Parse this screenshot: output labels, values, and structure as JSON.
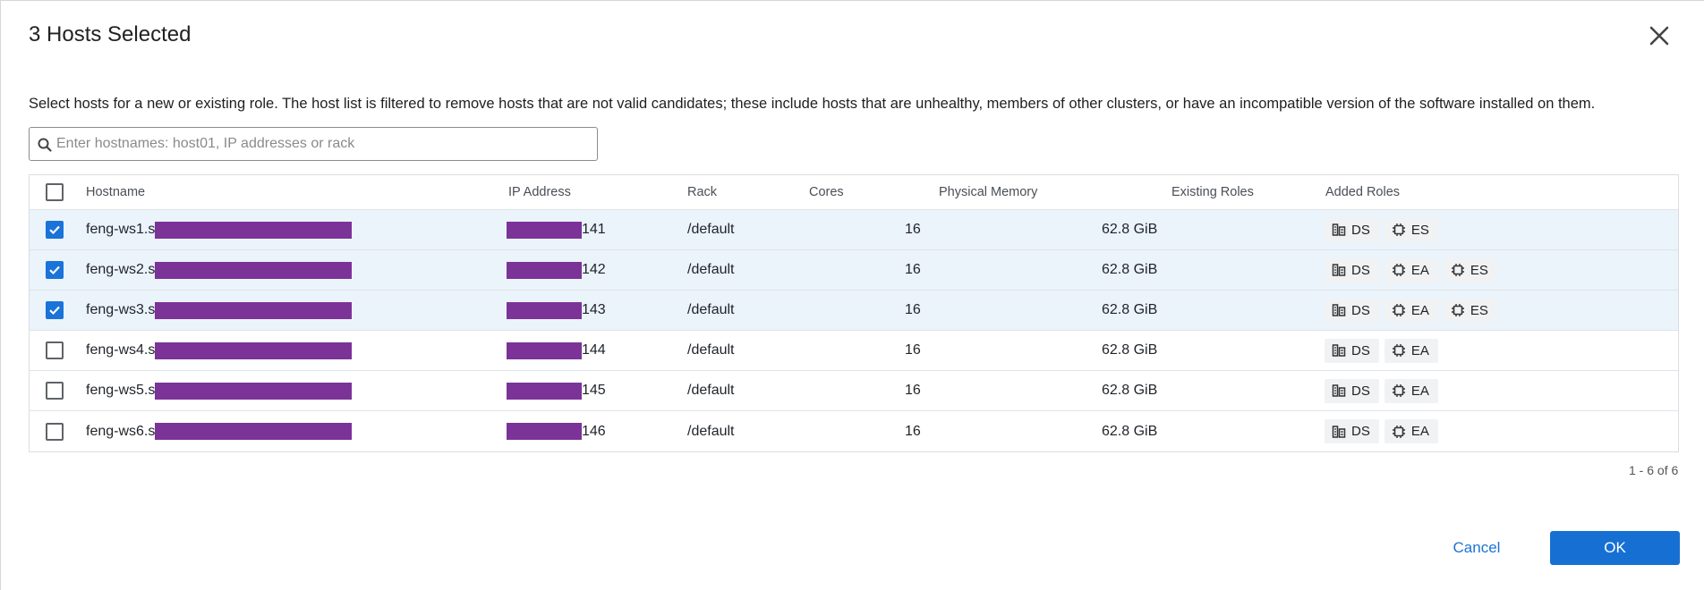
{
  "dialog": {
    "title": "3 Hosts Selected",
    "description": "Select hosts for a new or existing role. The host list is filtered to remove hosts that are not valid candidates; these include hosts that are unhealthy, members of other clusters, or have an incompatible version of the software installed on them."
  },
  "search": {
    "placeholder": "Enter hostnames: host01, IP addresses or rack"
  },
  "table": {
    "headers": {
      "hostname": "Hostname",
      "ip": "IP Address",
      "rack": "Rack",
      "cores": "Cores",
      "memory": "Physical Memory",
      "existing": "Existing Roles",
      "added": "Added Roles"
    },
    "rows": [
      {
        "checked": true,
        "hostname": "feng-ws1.s",
        "ip_suffix": "141",
        "rack": "/default",
        "cores": "16",
        "memory": "62.8 GiB",
        "roles": [
          "DS",
          "ES"
        ]
      },
      {
        "checked": true,
        "hostname": "feng-ws2.s",
        "ip_suffix": "142",
        "rack": "/default",
        "cores": "16",
        "memory": "62.8 GiB",
        "roles": [
          "DS",
          "EA",
          "ES"
        ]
      },
      {
        "checked": true,
        "hostname": "feng-ws3.s",
        "ip_suffix": "143",
        "rack": "/default",
        "cores": "16",
        "memory": "62.8 GiB",
        "roles": [
          "DS",
          "EA",
          "ES"
        ]
      },
      {
        "checked": false,
        "hostname": "feng-ws4.s",
        "ip_suffix": "144",
        "rack": "/default",
        "cores": "16",
        "memory": "62.8 GiB",
        "roles": [
          "DS",
          "EA"
        ]
      },
      {
        "checked": false,
        "hostname": "feng-ws5.s",
        "ip_suffix": "145",
        "rack": "/default",
        "cores": "16",
        "memory": "62.8 GiB",
        "roles": [
          "DS",
          "EA"
        ]
      },
      {
        "checked": false,
        "hostname": "feng-ws6.s",
        "ip_suffix": "146",
        "rack": "/default",
        "cores": "16",
        "memory": "62.8 GiB",
        "roles": [
          "DS",
          "EA"
        ]
      }
    ]
  },
  "pagination": "1 - 6 of 6",
  "buttons": {
    "cancel": "Cancel",
    "ok": "OK"
  },
  "colors": {
    "accent": "#1670d3",
    "selected_row": "#ebf3fb",
    "redaction": "#7b3398"
  }
}
